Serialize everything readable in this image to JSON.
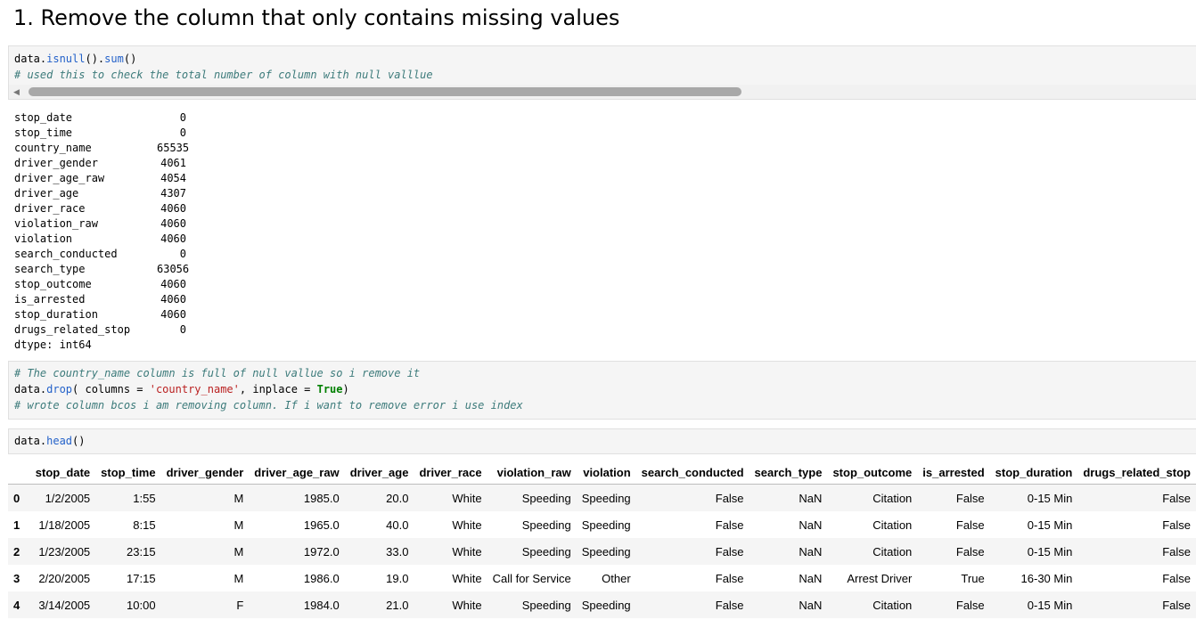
{
  "heading": "1. Remove the column that only contains missing values",
  "cell1": {
    "line1_pre": "data.",
    "line1_fn1": "isnull",
    "line1_mid": "().",
    "line1_fn2": "sum",
    "line1_post": "()",
    "line2_comment": "# used this to check the total number of column with null valllue"
  },
  "output": [
    {
      "key": "stop_date",
      "value": "0"
    },
    {
      "key": "stop_time",
      "value": "0"
    },
    {
      "key": "country_name",
      "value": "65535"
    },
    {
      "key": "driver_gender",
      "value": "4061"
    },
    {
      "key": "driver_age_raw",
      "value": "4054"
    },
    {
      "key": "driver_age",
      "value": "4307"
    },
    {
      "key": "driver_race",
      "value": "4060"
    },
    {
      "key": "violation_raw",
      "value": "4060"
    },
    {
      "key": "violation",
      "value": "4060"
    },
    {
      "key": "search_conducted",
      "value": "0"
    },
    {
      "key": "search_type",
      "value": "63056"
    },
    {
      "key": "stop_outcome",
      "value": "4060"
    },
    {
      "key": "is_arrested",
      "value": "4060"
    },
    {
      "key": "stop_duration",
      "value": "4060"
    },
    {
      "key": "drugs_related_stop",
      "value": "0"
    }
  ],
  "output_dtype": "dtype: int64",
  "cell2": {
    "line1_comment": "# The country_name column is full of null vallue so i remove it",
    "line2_pre": "data.",
    "line2_fn": "drop",
    "line2_a": "( columns = ",
    "line2_str": "'country_name'",
    "line2_b": ", inplace = ",
    "line2_kw": "True",
    "line2_c": ")",
    "line3_comment": "# wrote column bcos i am removing column. If i want to remove error i use index"
  },
  "cell3": {
    "pre": "data.",
    "fn": "head",
    "post": "()"
  },
  "table": {
    "columns": [
      "",
      "stop_date",
      "stop_time",
      "driver_gender",
      "driver_age_raw",
      "driver_age",
      "driver_race",
      "violation_raw",
      "violation",
      "search_conducted",
      "search_type",
      "stop_outcome",
      "is_arrested",
      "stop_duration",
      "drugs_related_stop"
    ],
    "rows": [
      [
        "0",
        "1/2/2005",
        "1:55",
        "M",
        "1985.0",
        "20.0",
        "White",
        "Speeding",
        "Speeding",
        "False",
        "NaN",
        "Citation",
        "False",
        "0-15 Min",
        "False"
      ],
      [
        "1",
        "1/18/2005",
        "8:15",
        "M",
        "1965.0",
        "40.0",
        "White",
        "Speeding",
        "Speeding",
        "False",
        "NaN",
        "Citation",
        "False",
        "0-15 Min",
        "False"
      ],
      [
        "2",
        "1/23/2005",
        "23:15",
        "M",
        "1972.0",
        "33.0",
        "White",
        "Speeding",
        "Speeding",
        "False",
        "NaN",
        "Citation",
        "False",
        "0-15 Min",
        "False"
      ],
      [
        "3",
        "2/20/2005",
        "17:15",
        "M",
        "1986.0",
        "19.0",
        "White",
        "Call for Service",
        "Other",
        "False",
        "NaN",
        "Arrest Driver",
        "True",
        "16-30 Min",
        "False"
      ],
      [
        "4",
        "3/14/2005",
        "10:00",
        "F",
        "1984.0",
        "21.0",
        "White",
        "Speeding",
        "Speeding",
        "False",
        "NaN",
        "Citation",
        "False",
        "0-15 Min",
        "False"
      ]
    ]
  }
}
